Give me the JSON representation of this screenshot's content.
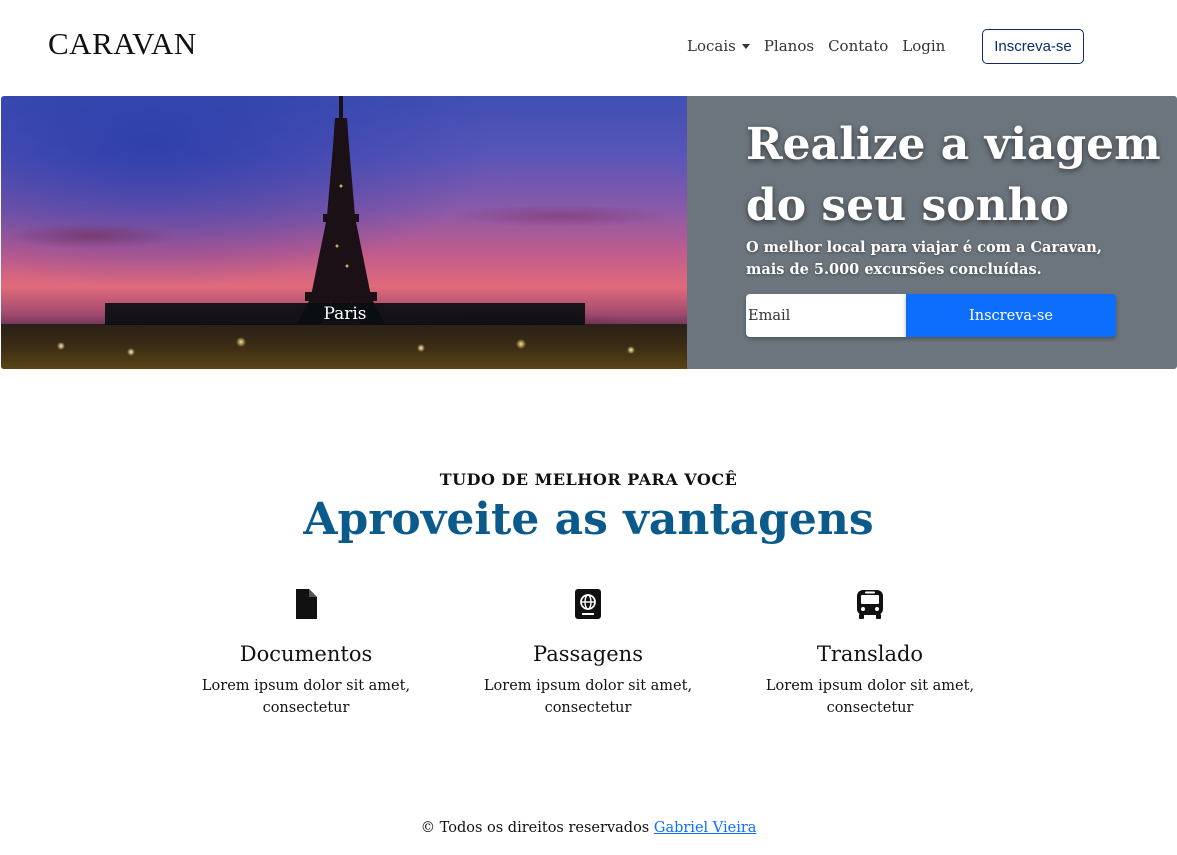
{
  "navbar": {
    "brand": "CARAVAN",
    "links": [
      "Locais",
      "Planos",
      "Contato",
      "Login"
    ],
    "cta_label": "Inscreva-se"
  },
  "hero": {
    "image_caption": "Paris",
    "title": "Realize a viagem do seu sonho",
    "subtitle": "O melhor local para viajar é com a Caravan, mais de 5.000 excursões concluídas.",
    "email_placeholder": "Email",
    "button_label": "Inscreva-se",
    "panel_color": "#6c757d",
    "button_color": "#0d6efd"
  },
  "benefits": {
    "eyebrow": "TUDO DE MELHOR PARA VOCÊ",
    "title": "Aproveite as vantagens",
    "title_color": "#0b5a8c",
    "items": [
      {
        "icon": "document-icon",
        "title": "Documentos",
        "text": "Lorem ipsum dolor sit amet, consectetur"
      },
      {
        "icon": "passport-icon",
        "title": "Passagens",
        "text": "Lorem ipsum dolor sit amet, consectetur"
      },
      {
        "icon": "bus-icon",
        "title": "Translado",
        "text": "Lorem ipsum dolor sit amet, consectetur"
      }
    ]
  },
  "footer": {
    "text": "© Todos os direitos reservados",
    "link_label": "Gabriel Vieira"
  }
}
